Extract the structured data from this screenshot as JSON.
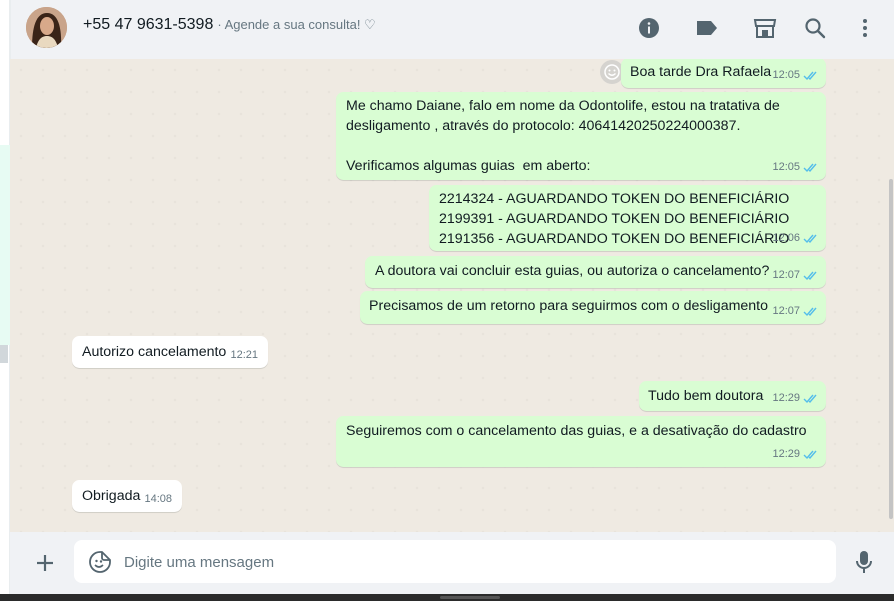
{
  "header": {
    "phone": "+55 47 9631-5398",
    "status": "· Agende a sua consulta! ♡",
    "icons": [
      "info-icon",
      "label-icon",
      "catalog-icon",
      "search-icon",
      "menu-icon"
    ]
  },
  "messages": [
    {
      "dir": "out",
      "text": "Boa tarde Dra Rafaela",
      "time": "12:05",
      "status": "read",
      "reaction": "smiley-icon"
    },
    {
      "dir": "out",
      "text": "Me chamo Daiane, falo em nome da Odontolife, estou na tratativa de\ndesligamento , através do protocolo: 40641420250224000387.\n\nVerificamos algumas guias  em aberto:",
      "time": "12:05",
      "status": "read"
    },
    {
      "dir": "out",
      "text": "2214324 - AGUARDANDO TOKEN DO BENEFICIÁRIO\n2199391 - AGUARDANDO TOKEN DO BENEFICIÁRIO\n2191356 - AGUARDANDO TOKEN DO BENEFICIÁRIO",
      "time": "12:06",
      "status": "read"
    },
    {
      "dir": "out",
      "text": "A doutora vai concluir esta guias, ou autoriza o cancelamento?",
      "time": "12:07",
      "status": "read"
    },
    {
      "dir": "out",
      "text": "Precisamos de um retorno para seguirmos com o desligamento",
      "time": "12:07",
      "status": "read"
    },
    {
      "dir": "in",
      "text": "Autorizo cancelamento",
      "time": "12:21"
    },
    {
      "dir": "out",
      "text": "Tudo bem doutora",
      "time": "12:29",
      "status": "read"
    },
    {
      "dir": "out",
      "text": "Seguiremos com o cancelamento das guias, e a desativação do cadastro",
      "time": "12:29",
      "status": "read"
    },
    {
      "dir": "in",
      "text": "Obrigada",
      "time": "14:08"
    }
  ],
  "composer": {
    "placeholder": "Digite uma mensagem"
  },
  "colors": {
    "outgoing_bubble": "#d9fdd3",
    "incoming_bubble": "#ffffff",
    "chat_background": "#efeae2",
    "header_background": "#f0f2f5",
    "read_ticks": "#53bdeb"
  }
}
